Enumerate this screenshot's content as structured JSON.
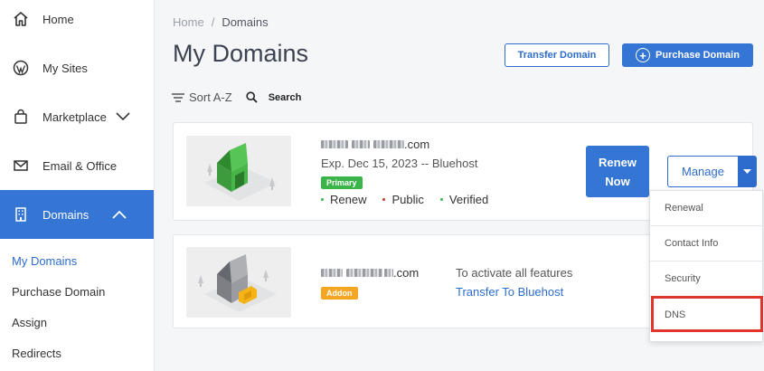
{
  "sidebar": {
    "items": [
      {
        "label": "Home",
        "icon": "home-icon"
      },
      {
        "label": "My Sites",
        "icon": "wordpress-icon"
      },
      {
        "label": "Marketplace",
        "icon": "shopping-bag-icon"
      },
      {
        "label": "Email & Office",
        "icon": "envelope-icon"
      },
      {
        "label": "Domains",
        "icon": "building-icon"
      }
    ],
    "subitems": [
      "My Domains",
      "Purchase Domain",
      "Assign",
      "Redirects"
    ]
  },
  "breadcrumb": {
    "home": "Home",
    "separator": "/",
    "current": "Domains"
  },
  "page_title": "My Domains",
  "buttons": {
    "transfer": "Transfer Domain",
    "purchase": "Purchase Domain"
  },
  "toolbar": {
    "sort": "Sort A-Z",
    "search": "Search"
  },
  "domains": [
    {
      "name_suffix": ".com",
      "expiry": "Exp. Dec 15, 2023 -- Bluehost",
      "badge": "Primary",
      "badge_color": "#3bb54a",
      "statuses": [
        {
          "label": "Renew",
          "color": "#3bb54a"
        },
        {
          "label": "Public",
          "color": "#d0342c"
        },
        {
          "label": "Verified",
          "color": "#3bb54a"
        }
      ],
      "renew_line1": "Renew",
      "renew_line2": "Now",
      "manage_label": "Manage"
    },
    {
      "name_suffix": ".com",
      "badge": "Addon",
      "badge_color": "#f5a623",
      "activate_text": "To activate all features",
      "transfer_link": "Transfer To Bluehost"
    }
  ],
  "manage_menu": [
    "Renewal",
    "Contact Info",
    "Security",
    "DNS"
  ],
  "colors": {
    "accent": "#3575d3",
    "highlight": "#e0342c"
  }
}
